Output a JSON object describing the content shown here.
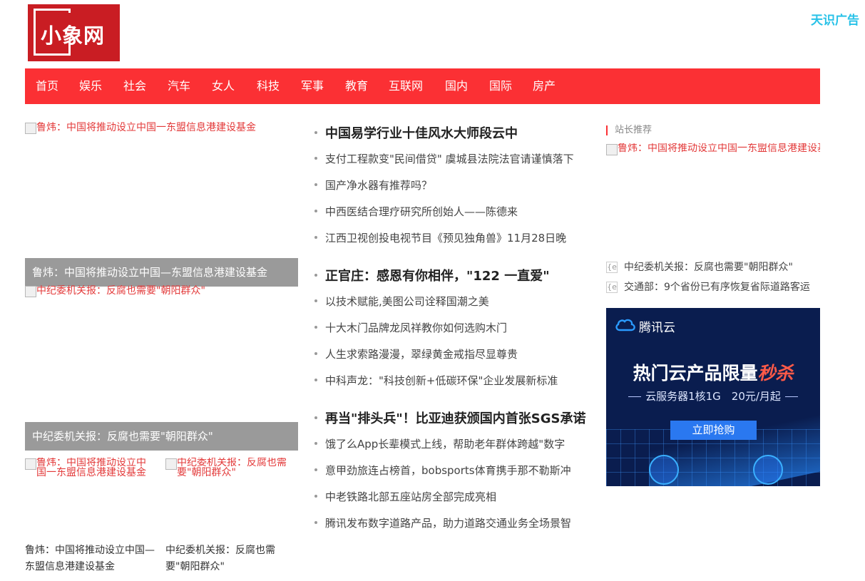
{
  "header": {
    "logo_text": "小象网",
    "ad_link": "天识广告"
  },
  "nav": {
    "items": [
      "首页",
      "娱乐",
      "社会",
      "汽车",
      "女人",
      "科技",
      "军事",
      "教育",
      "互联网",
      "国内",
      "国际",
      "房产"
    ]
  },
  "left": {
    "broken_images": [
      "鲁炜：中国将推动设立中国一东盟信息港建设基金",
      "中纪委机关报：反腐也需要\"朝阳群众\""
    ],
    "captions": [
      "鲁炜：中国将推动设立中国—东盟信息港建设基金",
      "中纪委机关报：反腐也需要\"朝阳群众\""
    ],
    "small_broken": [
      "鲁炜：中国将推动设立中国一东盟信息港建设基金",
      "中纪委机关报：反腐也需要\"朝阳群众\""
    ],
    "small_captions": [
      "鲁炜：中国将推动设立中国—东盟信息港建设基金",
      "中纪委机关报：反腐也需要\"朝阳群众\""
    ]
  },
  "middle": {
    "groups": [
      {
        "heading": "中国易学行业十佳风水大师段云中",
        "items": [
          "支付工程款变\"民间借贷\" 虞城县法院法官请谨慎落下",
          "国产净水器有推荐吗？",
          "中西医结合理疗研究所创始人——陈德来",
          "江西卫视创投电视节目《预见独角兽》11月28日晚"
        ]
      },
      {
        "heading": "正官庄：感恩有你相伴，\"122 一直爱\"",
        "items": [
          "以技术赋能,美图公司诠释国潮之美",
          "十大木门品牌龙凤祥教你如何选购木门",
          "人生求索路漫漫，翠绿黄金戒指尽显尊贵",
          "中科声龙：\"科技创新+低碳环保\"企业发展新标准"
        ]
      },
      {
        "heading": "再当\"排头兵\"！比亚迪获颁国内首张SGS承诺",
        "items": [
          "饿了么App长辈模式上线，帮助老年群体跨越\"数字",
          "意甲劲旅连占榜首，bobsports体育携手那不勒斯冲",
          "中老铁路北部五座站房全部完成亮相",
          "腾讯发布数字道路产品，助力道路交通业务全场景智"
        ]
      }
    ]
  },
  "right": {
    "rec_title": "站长推荐",
    "rec_broken_image": "鲁炜：中国将推动设立中国一东盟信息港建设基金",
    "links": [
      "中纪委机关报：反腐也需要\"朝阳群众\"",
      "交通部：9个省份已有序恢复省际道路客运"
    ],
    "link_icon": "{e",
    "ad": {
      "brand": "腾讯云",
      "headline_main": "热门云产品限量",
      "headline_highlight": "秒杀",
      "sub": "云服务器1核1G　20元/月起",
      "cta": "立即抢购"
    }
  },
  "colors": {
    "nav_bg": "#fb3034",
    "logo_bg": "#c91d23",
    "ad_link": "#28c2e8",
    "caption_bg": "rgba(120,120,120,0.75)",
    "broken_alt": "#e33a3a"
  }
}
